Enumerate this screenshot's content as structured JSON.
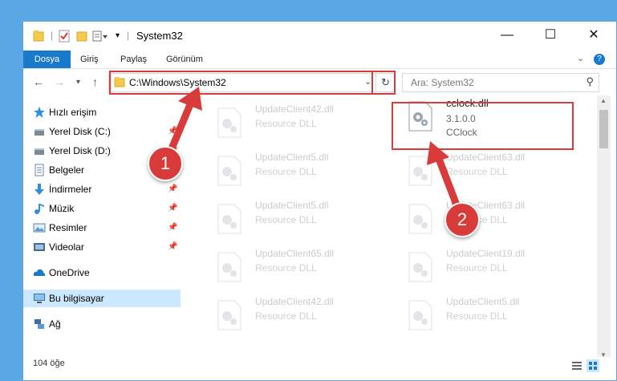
{
  "window": {
    "title": "System32",
    "minimize_glyph": "—",
    "maximize_glyph": "☐",
    "close_glyph": "✕"
  },
  "ribbon": {
    "tabs": [
      "Dosya",
      "Giriş",
      "Paylaş",
      "Görünüm"
    ]
  },
  "navbar": {
    "address": "C:\\Windows\\System32",
    "search_placeholder": "Ara: System32"
  },
  "sidebar": {
    "items": [
      {
        "label": "Hızlı erişim",
        "icon": "star-icon"
      },
      {
        "label": "Yerel Disk (C:)",
        "icon": "drive-icon"
      },
      {
        "label": "Yerel Disk (D:)",
        "icon": "drive-icon"
      },
      {
        "label": "Belgeler",
        "icon": "documents-icon"
      },
      {
        "label": "İndirmeler",
        "icon": "download-icon"
      },
      {
        "label": "Müzik",
        "icon": "music-icon"
      },
      {
        "label": "Resimler",
        "icon": "pictures-icon"
      },
      {
        "label": "Videolar",
        "icon": "video-icon"
      },
      {
        "label": "OneDrive",
        "icon": "cloud-icon"
      },
      {
        "label": "Bu bilgisayar",
        "icon": "computer-icon"
      },
      {
        "label": "Ağ",
        "icon": "network-icon"
      }
    ]
  },
  "files": {
    "highlighted": {
      "name": "cclock.dll",
      "version": "3.1.0.0",
      "product": "CClock"
    },
    "others": [
      {
        "name": "UpdateClient42.dll",
        "desc": "Resource DLL"
      },
      {
        "name": "UpdateClient5.dll",
        "desc": "Resource DLL"
      },
      {
        "name": "UpdateClient63.dll",
        "desc": "Resource DLL"
      },
      {
        "name": "UpdateClient5.dll",
        "desc": "Resource DLL"
      },
      {
        "name": "UpdateClient63.dll",
        "desc": "Resource DLL"
      },
      {
        "name": "UpdateClient65.dll",
        "desc": "Resource DLL"
      },
      {
        "name": "UpdateClient19.dll",
        "desc": "Resource DLL"
      },
      {
        "name": "UpdateClient42.dll",
        "desc": "Resource DLL"
      },
      {
        "name": "UpdateClient5.dll",
        "desc": "Resource DLL"
      }
    ]
  },
  "status": {
    "item_count": "104 öğe"
  },
  "annotations": {
    "step1": "1",
    "step2": "2",
    "color": "#d93a3a"
  }
}
